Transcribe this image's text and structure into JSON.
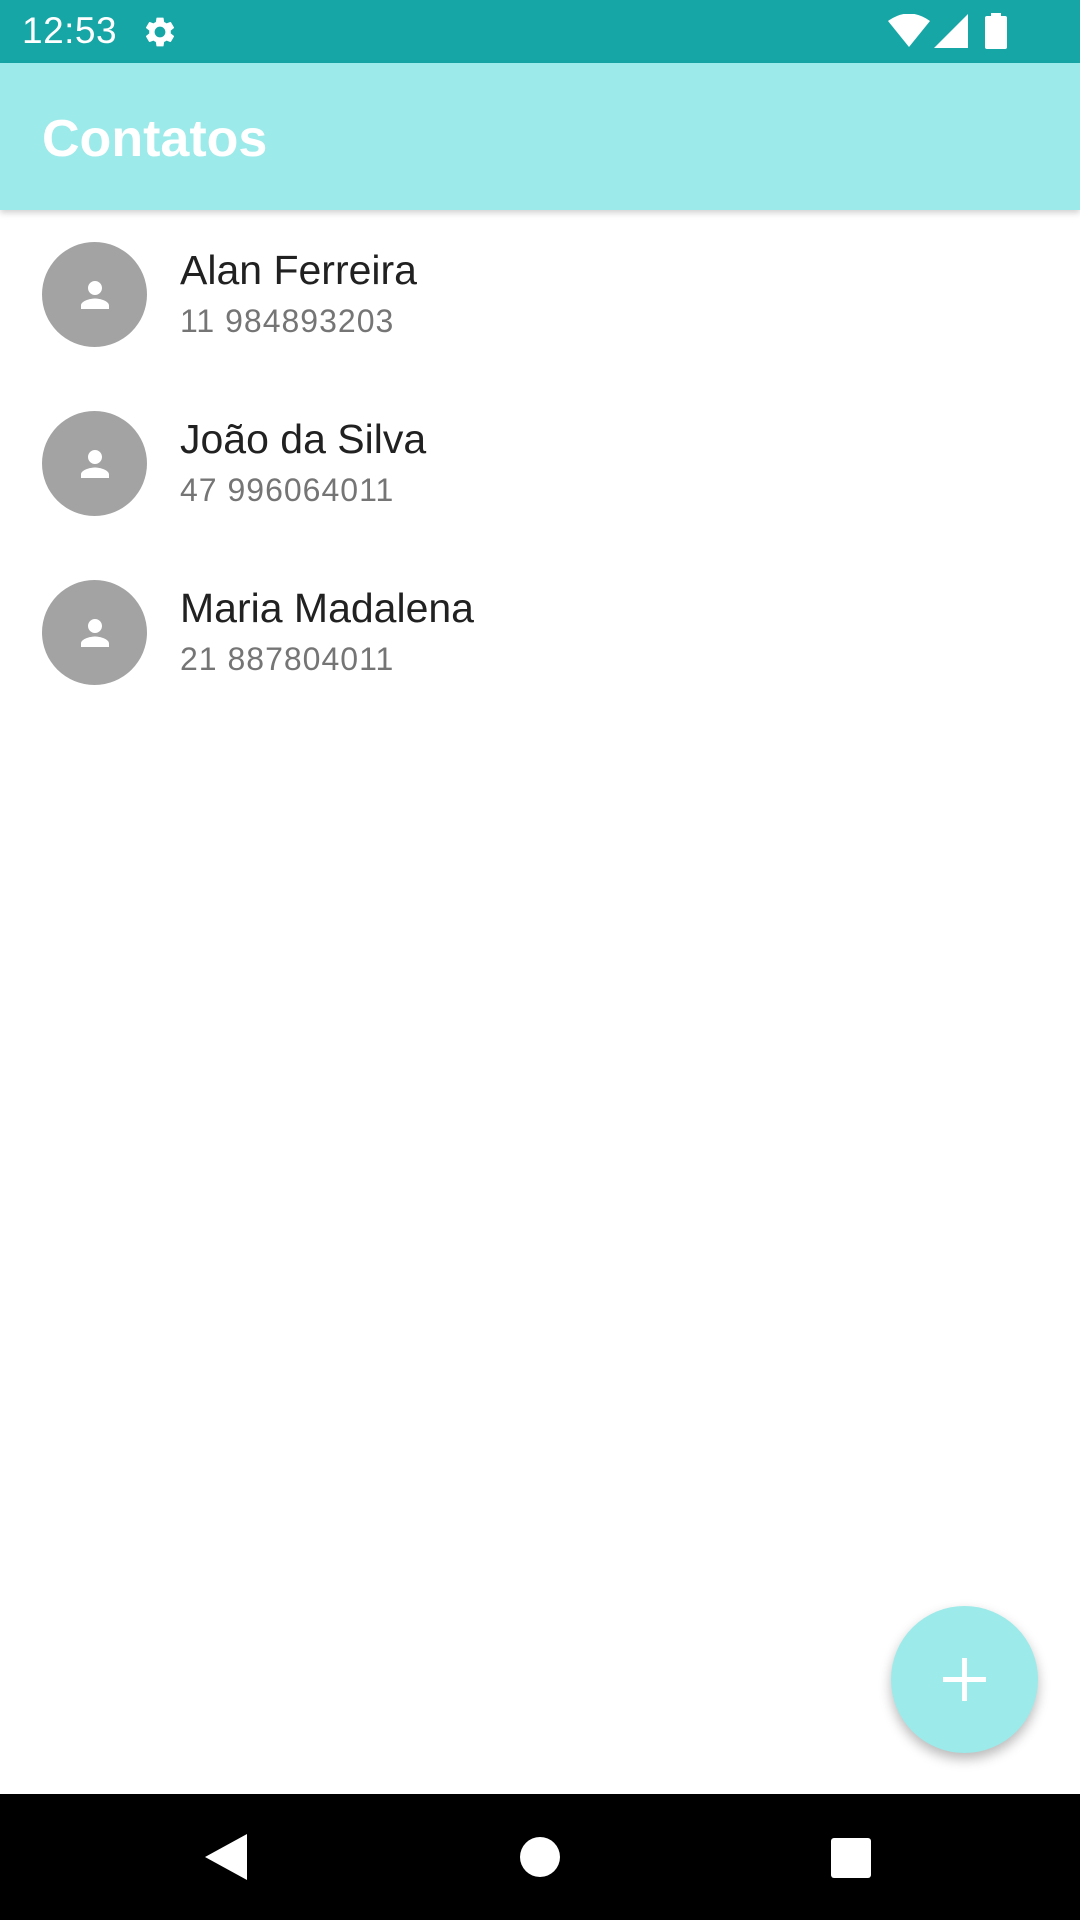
{
  "status_bar": {
    "time": "12:53",
    "icons": [
      "gear-icon",
      "wifi-icon",
      "signal-icon",
      "battery-icon"
    ],
    "color": "#16a6a6"
  },
  "app_bar": {
    "title": "Contatos",
    "color": "#9ceaea"
  },
  "contacts": [
    {
      "name": "Alan Ferreira",
      "phone": "11 984893203",
      "icon": "person-icon"
    },
    {
      "name": "João da Silva",
      "phone": "47 996064011",
      "icon": "person-icon"
    },
    {
      "name": "Maria Madalena",
      "phone": "21 887804011",
      "icon": "person-icon"
    }
  ],
  "fab": {
    "icon": "plus-icon",
    "color": "#9ceaea"
  },
  "nav_bar": {
    "icons": [
      "back-icon",
      "home-icon",
      "recents-icon"
    ]
  }
}
